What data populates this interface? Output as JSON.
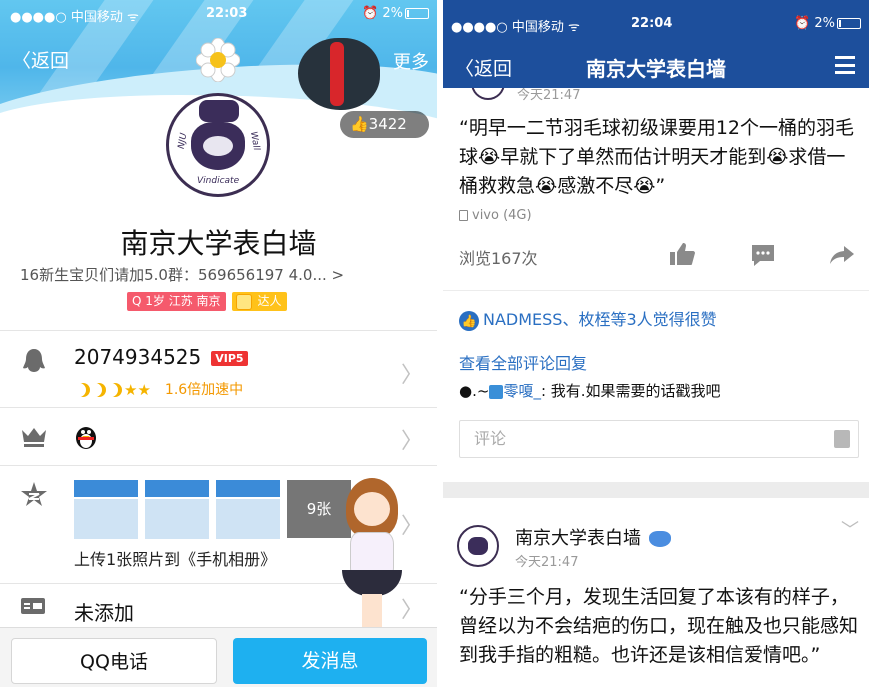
{
  "left": {
    "status": {
      "carrier": "●●●●○ 中国移动 ᯤ",
      "time": "22:03",
      "battery": "⏰ 2%"
    },
    "nav": {
      "back": "〈返回",
      "more": "更多"
    },
    "likes": "👍3422",
    "profile": {
      "name": "南京大学表白墙",
      "signature": "16新生宝贝们请加5.0群：569656197  4.0... >",
      "tag_location": "Q 1岁 江苏 南京",
      "tag_expert": "达人"
    },
    "qq": {
      "number": "2074934525",
      "vip": "VIP5",
      "speed": "1.6倍加速中"
    },
    "album": {
      "count": "9张",
      "upload": "上传1张照片到《手机相册》"
    },
    "card": {
      "value": "未添加"
    },
    "buttons": {
      "call": "QQ电话",
      "message": "发消息"
    }
  },
  "right": {
    "status": {
      "carrier": "●●●●○ 中国移动 ᯤ",
      "time": "22:04",
      "battery": "⏰ 2%"
    },
    "nav": {
      "back": "〈返回",
      "title": "南京大学表白墙"
    },
    "clipped_time": "今天21:47",
    "post1": {
      "text": "“明早一二节羽毛球初级课要用12个一桶的羽毛球😭早就下了单然而估计明天才能到😭求借一桶救救急😭感激不尽😭”",
      "device": "vivo (4G)",
      "views": "浏览167次"
    },
    "likers": "NADMESS、枚桎等3人觉得很赞",
    "view_all_comments": "查看全部评论回复",
    "comment": {
      "prefix": "●.~",
      "user": "零嗄_",
      "text": ": 我有.如果需要的话戳我吧"
    },
    "comment_placeholder": "评论",
    "post2": {
      "author": "南京大学表白墙",
      "time": "今天21:47",
      "text": "“分手三个月，发现生活回复了本该有的样子，曾经以为不会结疤的伤口，现在触及也只能感知到我手指的粗糙。也许还是该相信爱情吧。”"
    }
  },
  "colors": {
    "brand_blue": "#1d4f9c",
    "qq_blue": "#1eb0f0",
    "link_blue": "#2a6fc2",
    "vip_red": "#e33333"
  }
}
